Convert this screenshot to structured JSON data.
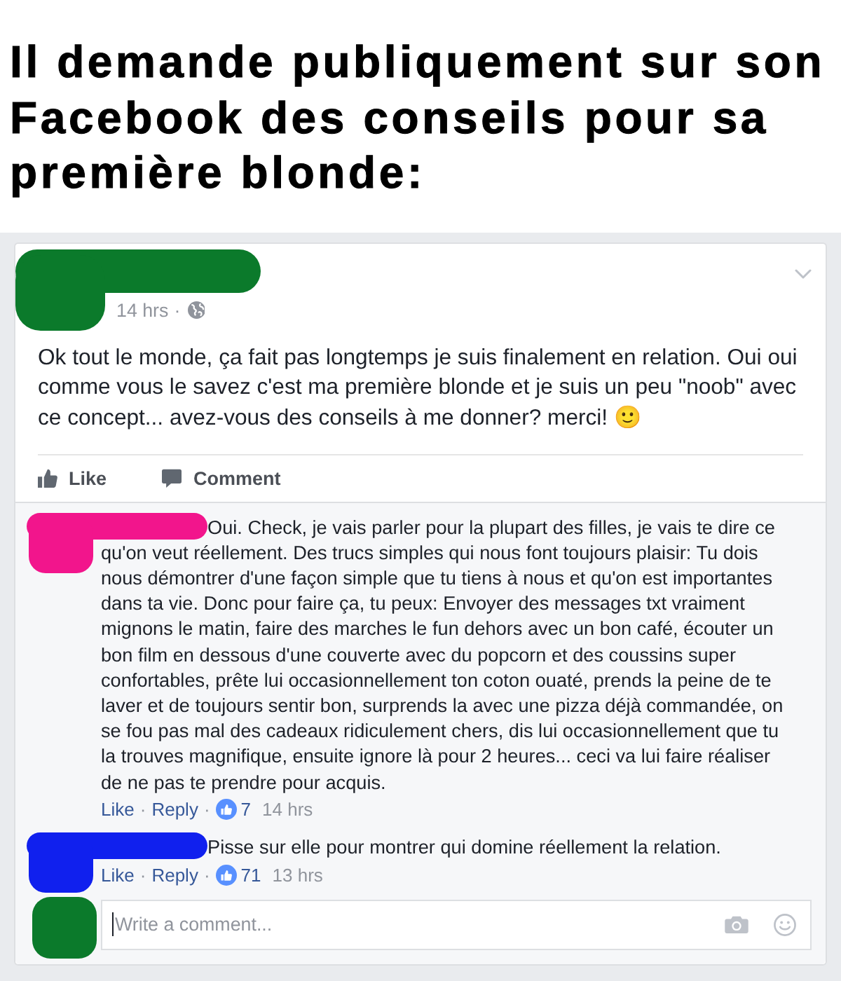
{
  "headline": "Il demande publiquement sur son Facebook des conseils pour sa première blonde:",
  "post": {
    "time": "14 hrs",
    "separator": "·",
    "text": "Ok tout le monde, ça fait pas longtemps je suis finalement en relation. Oui oui comme vous le savez c'est ma première blonde et je suis un peu \"noob\" avec ce concept... avez-vous des conseils à me donner? merci! 🙂",
    "actions": [
      {
        "kind": "like",
        "label": "Like"
      },
      {
        "kind": "comment",
        "label": "Comment"
      }
    ]
  },
  "comments": [
    {
      "color": "#f2158c",
      "text": "Oui. Check, je vais parler pour la plupart des filles, je vais te dire ce qu'on veut réellement. Des trucs simples qui nous font toujours plaisir: Tu dois nous démontrer d'une façon simple que tu tiens à nous et qu'on est importantes dans ta vie. Donc pour faire ça, tu peux: Envoyer des messages txt vraiment mignons le matin, faire des marches le fun dehors avec un bon café, écouter un bon film en dessous d'une couverte avec du popcorn et des coussins super confortables, prête lui occasionnellement ton coton ouaté, prends la peine de te laver et de toujours sentir bon, surprends la avec une pizza déjà commandée, on se fou pas mal des cadeaux ridiculement chers, dis lui occasionnellement que tu la trouves magnifique, ensuite ignore là pour 2 heures... ceci va lui faire réaliser de ne pas te prendre pour acquis.",
      "meta": [
        {
          "kind": "like",
          "text": "Like"
        },
        {
          "kind": "dot",
          "text": "·"
        },
        {
          "kind": "reply",
          "text": "Reply"
        },
        {
          "kind": "dot",
          "text": "·"
        },
        {
          "kind": "reactions",
          "text": "7"
        },
        {
          "kind": "time",
          "text": "14 hrs"
        }
      ]
    },
    {
      "color": "#1020ee",
      "text": "Pisse sur elle pour montrer qui domine réellement la relation.",
      "meta": [
        {
          "kind": "like",
          "text": "Like"
        },
        {
          "kind": "dot",
          "text": "·"
        },
        {
          "kind": "reply",
          "text": "Reply"
        },
        {
          "kind": "dot",
          "text": "·"
        },
        {
          "kind": "reactions",
          "text": "71"
        },
        {
          "kind": "time",
          "text": "13 hrs"
        }
      ]
    }
  ],
  "composer": {
    "placeholder": "Write a comment..."
  }
}
